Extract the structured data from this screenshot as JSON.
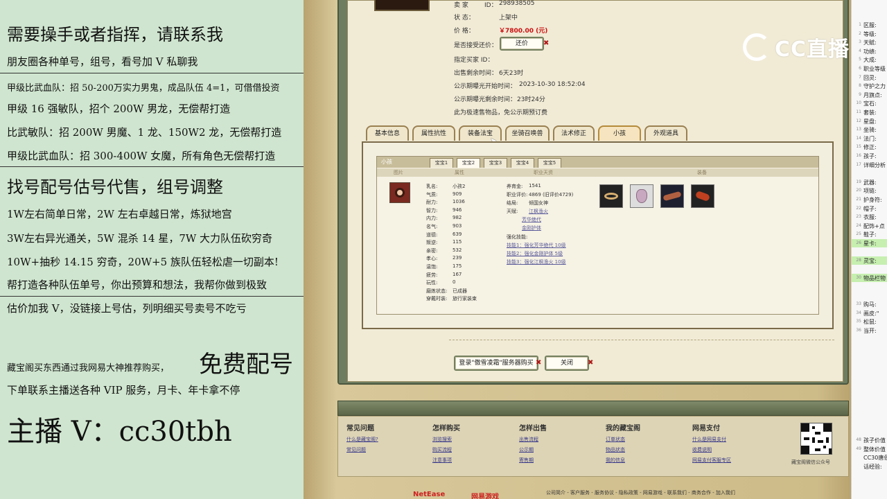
{
  "stream_panel": {
    "lines": [
      "需要操手或者指挥，请联系我",
      "朋友圈各种单号，组号，看号加 V 私聊我",
      "甲级比武血队：招 50-200万实力男鬼，成品队伍 4=1，可借借投资",
      "甲级 16 强敏队，招个 200W 男龙，无偿帮打造",
      "比武敏队：招 200W 男魔、1 龙、150W2 龙，无偿帮打造",
      "甲级比武血队：招 300-400W 女魔，所有角色无偿帮打造",
      "找号配号估号代售，组号调整",
      "1W左右简单日常，2W 左右卓越日常，炼狱地宫",
      "3W左右异光通关，5W 混杀 14 星，7W 大力队伍砍穷奇",
      "10W+抽秒 14.15 穷奇，20W+5 族队伍轻松虐一切副本!",
      "帮打造各种队伍单号，你出预算和想法，我帮你做到极致",
      "估价加我 V，没链接上号估，列明细买号卖号不吃亏",
      "藏宝阁买东西通过我网易大神推荐购买，",
      "免费配号",
      "下单联系主播送各种 VIP 服务，月卡、年卡拿不停",
      "主播 V：cc30tbh"
    ]
  },
  "listing": {
    "seller_label": "卖 家",
    "id_label": "ID：",
    "id_value": "298938505",
    "status_label": "状 态：",
    "status_value": "上架中",
    "price_label": "价 格：",
    "price_value": "￥7800.00 (元)",
    "counter_offer_label": "是否接受还价：",
    "counter_offer_button": "还价",
    "designated_buyer_label": "指定买家 ID：",
    "remaining_label": "出售剩余时间：",
    "remaining_value": "6天23时",
    "publicity_start_label": "公示期曝光开始时间：",
    "publicity_start_value": "2023-10-30 18:52:04",
    "publicity_remaining_label": "公示期曝光剩余时间：",
    "publicity_remaining_value": "23时24分",
    "fast_sale_note": "此为极速售物品，免公示期预订费"
  },
  "tabs": [
    "基本信息",
    "属性抗性",
    "装备法宝",
    "坐骑召唤兽",
    "法术修正",
    "小孩",
    "外观道具"
  ],
  "child_panel": {
    "title": "小孩",
    "sub_tabs": [
      "宝宝1",
      "宝宝2",
      "宝宝3",
      "宝宝4",
      "宝宝5"
    ],
    "col_headers": [
      "图片",
      "属性",
      "职业天资",
      "装备"
    ],
    "attributes": [
      {
        "label": "乳名:",
        "value": "小孩2"
      },
      {
        "label": "气质:",
        "value": "909"
      },
      {
        "label": "耐力:",
        "value": "1036"
      },
      {
        "label": "智力:",
        "value": "946"
      },
      {
        "label": "内力:",
        "value": "982"
      },
      {
        "label": "名气:",
        "value": "903"
      },
      {
        "label": "道德:",
        "value": "639"
      },
      {
        "label": "叛逆:",
        "value": "115"
      },
      {
        "label": "亲密:",
        "value": "532"
      },
      {
        "label": "孝心:",
        "value": "239"
      },
      {
        "label": "温饱:",
        "value": "175"
      },
      {
        "label": "疲劳:",
        "value": "167"
      },
      {
        "label": "玩性:",
        "value": "0"
      },
      {
        "label": "磨炼状态:",
        "value": "已成器"
      },
      {
        "label": "穿戴时装:",
        "value": "旅行家装束"
      }
    ],
    "career": [
      {
        "label": "养育金:",
        "value": "1541"
      },
      {
        "label": "职业评价:",
        "value": "4869 (旧评价4729)"
      },
      {
        "label": "结局:",
        "value": "倾国女神"
      },
      {
        "label": "天赋:",
        "value": "江枫渔火"
      }
    ],
    "talent_links": [
      "芳华绝代",
      "金刚护体"
    ],
    "skill_label": "强化技能:",
    "skills": [
      "技能1：强化芳华绝代 10级",
      "技能2：强化金刚护体 5级",
      "技能3：强化江枫渔火 10级"
    ],
    "equipment_icons": [
      "bracelet-icon",
      "pouch-icon",
      "scroll-icon",
      "charm-icon"
    ]
  },
  "actions": {
    "login_buy": "登录\"傲雪凌霜\"服务器购买",
    "close": "关闭"
  },
  "footer": {
    "columns": [
      {
        "title": "常见问题",
        "links": [
          "什么是藏宝阁?",
          "常见问题"
        ]
      },
      {
        "title": "怎样购买",
        "links": [
          "浏览搜索",
          "购买流程",
          "注意事项"
        ]
      },
      {
        "title": "怎样出售",
        "links": [
          "出售流程",
          "公示期",
          "寄售期"
        ]
      },
      {
        "title": "我的藏宝阁",
        "links": [
          "订单状态",
          "物品状态",
          "我的信息"
        ]
      },
      {
        "title": "网易支付",
        "links": [
          "什么是网易支付",
          "收费说明",
          "网易支付客服专区"
        ]
      }
    ],
    "qr_caption": "藏宝阁微信公众号",
    "bottom_links": "公司简介 - 客户服务 - 服务协议 - 隐私政策 - 网易游戏 - 联系我们 - 商务合作 - 加入我们",
    "brand_left": "NetEase",
    "brand_right": "网易游戏"
  },
  "watermark": "CC直播",
  "sheet": {
    "rows": [
      {
        "n": "1",
        "t": "区服:"
      },
      {
        "n": "2",
        "t": "等级:"
      },
      {
        "n": "3",
        "t": "天赋:"
      },
      {
        "n": "4",
        "t": "功绩:"
      },
      {
        "n": "5",
        "t": "大成:"
      },
      {
        "n": "6",
        "t": "职业等级"
      },
      {
        "n": "7",
        "t": "回灵:"
      },
      {
        "n": "8",
        "t": "守护之力"
      },
      {
        "n": "9",
        "t": "月旗点:"
      },
      {
        "n": "10",
        "t": "宝石:"
      },
      {
        "n": "11",
        "t": "套装:"
      },
      {
        "n": "12",
        "t": "星盘:"
      },
      {
        "n": "13",
        "t": "坐骑:"
      },
      {
        "n": "14",
        "t": "法门:"
      },
      {
        "n": "15",
        "t": "修正:"
      },
      {
        "n": "16",
        "t": "孩子:"
      },
      {
        "n": "17",
        "t": "详细分析"
      },
      {
        "n": "",
        "t": ""
      },
      {
        "n": "19",
        "t": "武器:"
      },
      {
        "n": "20",
        "t": "项链:"
      },
      {
        "n": "21",
        "t": "护身符:"
      },
      {
        "n": "22",
        "t": "帽子:"
      },
      {
        "n": "23",
        "t": "衣服:"
      },
      {
        "n": "24",
        "t": "配饰+点"
      },
      {
        "n": "25",
        "t": "鞋子:"
      },
      {
        "n": "26",
        "t": "星卡:"
      },
      {
        "n": "",
        "t": ""
      },
      {
        "n": "28",
        "t": "灵宝:"
      },
      {
        "n": "",
        "t": ""
      },
      {
        "n": "30",
        "t": "物品栏物"
      },
      {
        "n": "",
        "t": ""
      },
      {
        "n": "",
        "t": ""
      },
      {
        "n": "33",
        "t": "购马:"
      },
      {
        "n": "34",
        "t": "画皮:\""
      },
      {
        "n": "35",
        "t": "松鼠:"
      },
      {
        "n": "36",
        "t": "当开:"
      }
    ],
    "bottom_rows": [
      {
        "n": "48",
        "t": "孩子价值"
      },
      {
        "n": "49",
        "t": "整体价值"
      },
      {
        "n": "",
        "t": "CC30唐佰"
      },
      {
        "n": "",
        "t": "话经验:"
      }
    ]
  }
}
